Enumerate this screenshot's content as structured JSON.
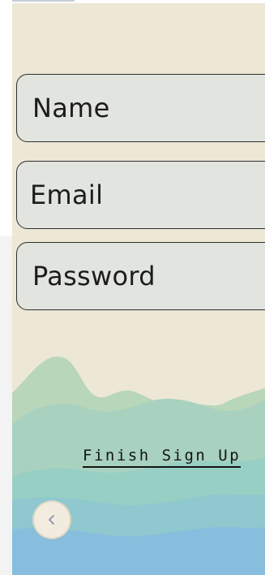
{
  "form": {
    "name_placeholder": "Name",
    "email_placeholder": "Email",
    "password_placeholder": "Password"
  },
  "actions": {
    "finish_label": "Finish Sign Up",
    "back_icon": "chevron-left-icon"
  },
  "colors": {
    "background": "#ede7d6",
    "field_fill": "#e1e4df",
    "wave_light": "#b8d6ba",
    "wave_mid": "#98cfc4",
    "wave_blue": "#87bedd"
  }
}
